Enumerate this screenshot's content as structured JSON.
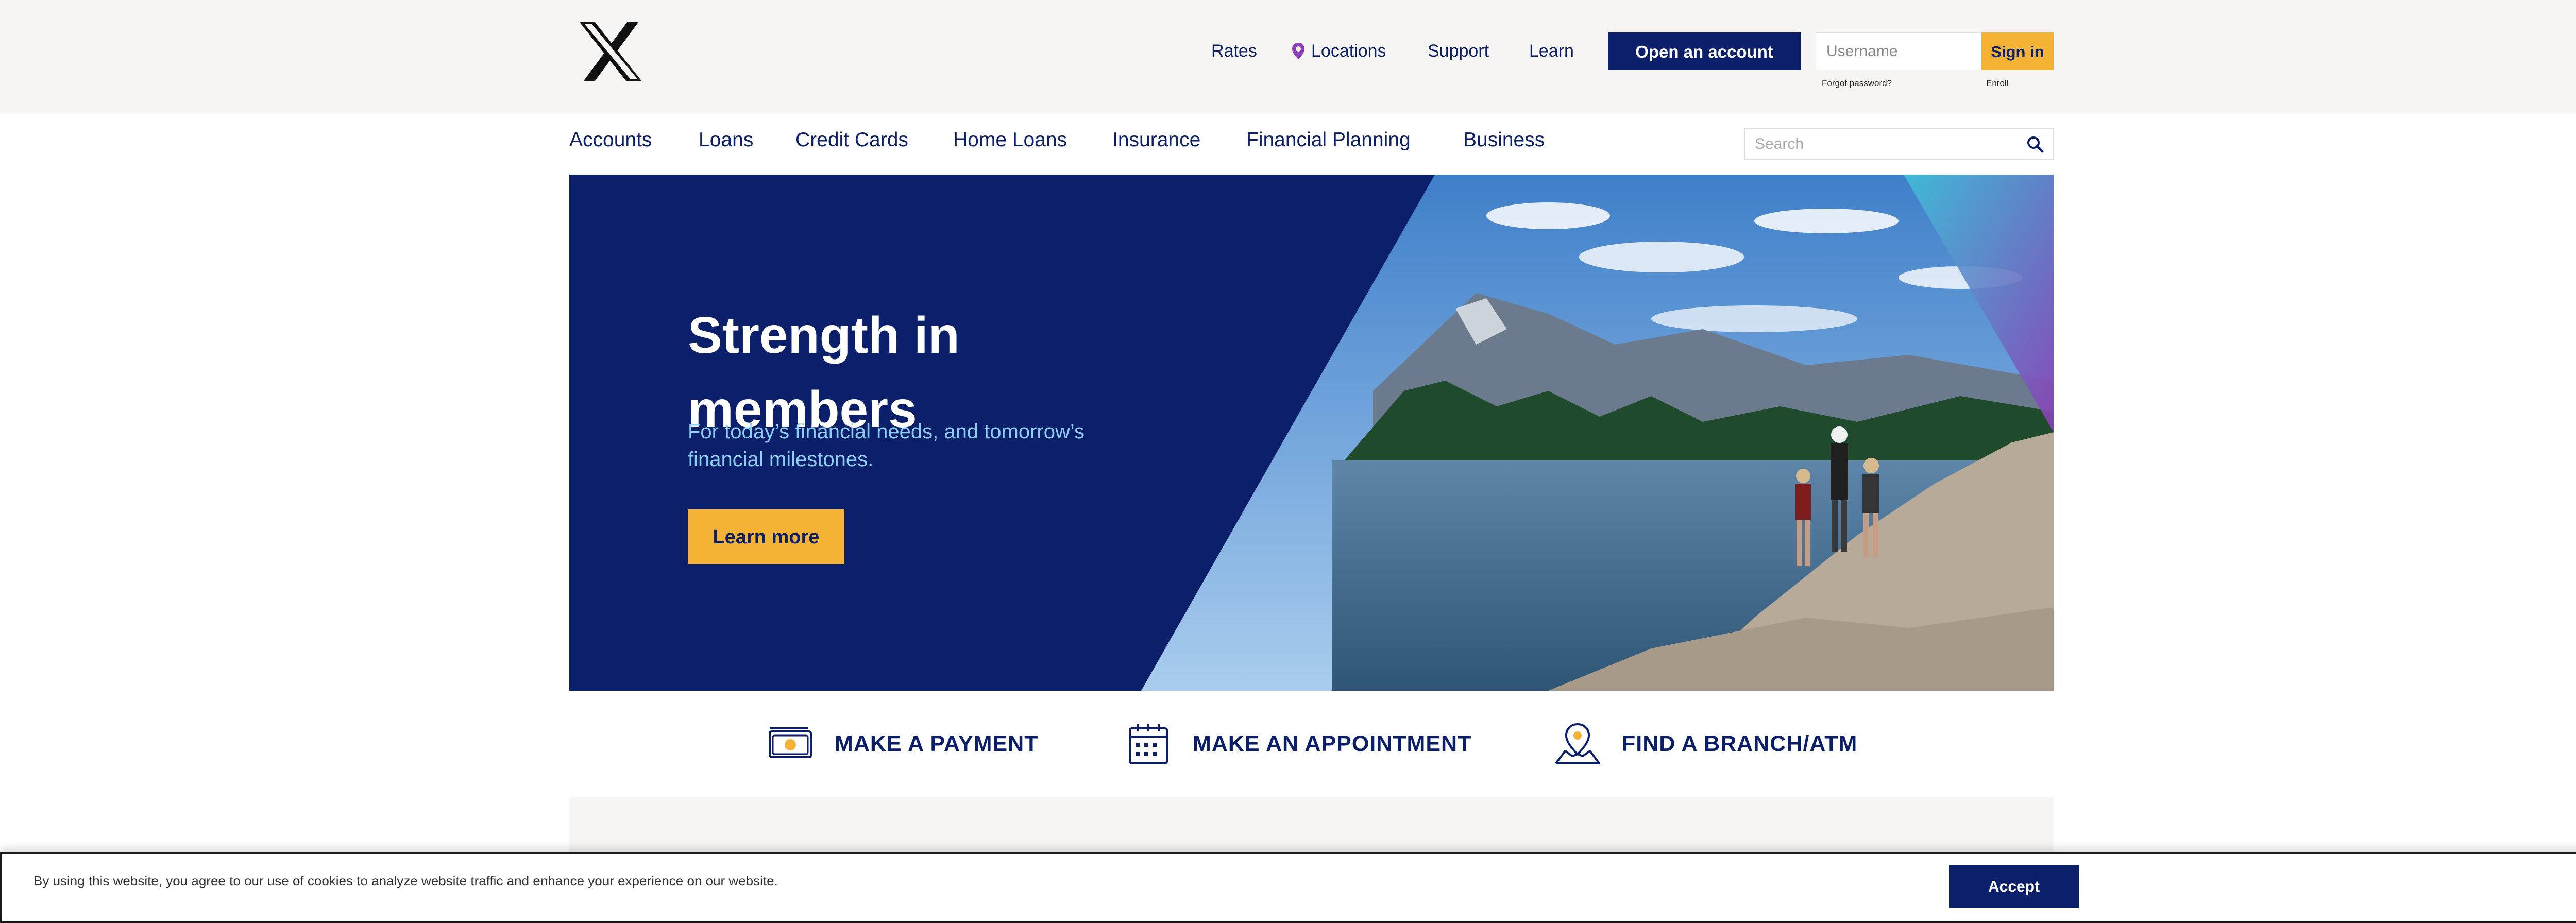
{
  "colors": {
    "navy": "#0b1f6b",
    "gold": "#f5b335",
    "light_blue": "#8ed0f5",
    "topbar_bg": "#f6f5f4",
    "pin_purple": "#8a3fb5"
  },
  "header": {
    "logo_icon": "x-logo-icon",
    "links": {
      "rates": "Rates",
      "locations": "Locations",
      "support": "Support",
      "learn": "Learn"
    },
    "open_account": "Open an account",
    "username_placeholder": "Username",
    "sign_in": "Sign in",
    "forgot_password": "Forgot password?",
    "enroll": "Enroll"
  },
  "nav": {
    "items": [
      "Accounts",
      "Loans",
      "Credit Cards",
      "Home Loans",
      "Insurance",
      "Financial Planning",
      "Business"
    ],
    "search_placeholder": "Search",
    "search_icon": "search-icon"
  },
  "hero": {
    "title": "Strength in members",
    "subtitle": "For today’s financial needs, and tomorrow’s financial milestones.",
    "cta": "Learn more",
    "image": "hikers-by-mountain-lake"
  },
  "quick_links": [
    {
      "label": "MAKE A PAYMENT",
      "icon": "cash-payment-icon"
    },
    {
      "label": "MAKE AN APPOINTMENT",
      "icon": "calendar-icon"
    },
    {
      "label": "FIND A BRANCH/ATM",
      "icon": "map-pin-icon"
    }
  ],
  "cookie": {
    "text": "By using this website, you agree to our use of cookies to analyze website traffic and enhance your experience on our website.",
    "accept": "Accept",
    "close_icon": "close-icon"
  }
}
